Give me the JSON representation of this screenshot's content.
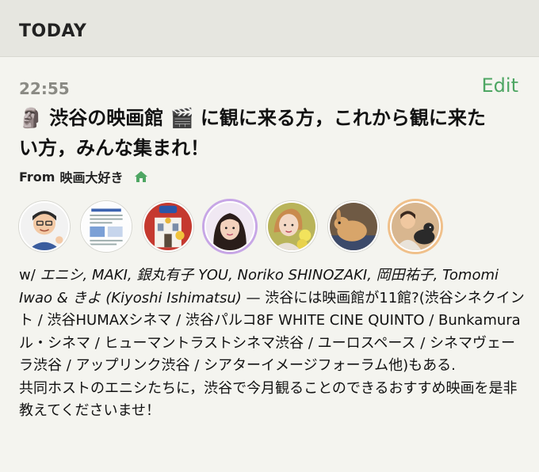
{
  "header": {
    "section_label": "TODAY"
  },
  "post": {
    "time": "22:55",
    "edit_label": "Edit",
    "title": "🗿 渋谷の映画館 🎬 に観に来る方，これから観に来たい方，みんな集まれ！",
    "from_prefix": "From",
    "from_name": "映画大好き",
    "home_icon": "home-icon",
    "home_icon_color": "#4ea663",
    "avatars": [
      {
        "icon": "cartoon-man-avatar"
      },
      {
        "icon": "document-thumbnail-avatar"
      },
      {
        "icon": "building-busy-avatar"
      },
      {
        "icon": "woman-long-hair-avatar"
      },
      {
        "icon": "woman-flowers-avatar"
      },
      {
        "icon": "rabbit-avatar"
      },
      {
        "icon": "man-with-dog-avatar"
      }
    ],
    "participants_prefix": "w/ ",
    "participants": "エニシ, MAKI, 銀丸有子 YOU, Noriko SHINOZAKI, 岡田祐子, Tomomi Iwao & きよ (Kiyoshi Ishimatsu)",
    "description": " — 渋谷には映画館が11館?(渋谷シネクイント / 渋谷HUMAXシネマ / 渋谷パルコ8F WHITE CINE QUINTO  / Bunkamura ル・シネマ / ヒューマントラストシネマ渋谷 / ユーロスペース / シネマヴェーラ渋谷 / アップリンク渋谷 / シアターイメージフォーラム他)もある.",
    "description_2": "共同ホストのエニシたちに，渋谷で今月観ることのできるおすすめ映画を是非教えてくださいませ！"
  },
  "colors": {
    "accent": "#4ea663",
    "background": "#f4f4ef",
    "header_bg": "#e6e6e0"
  }
}
